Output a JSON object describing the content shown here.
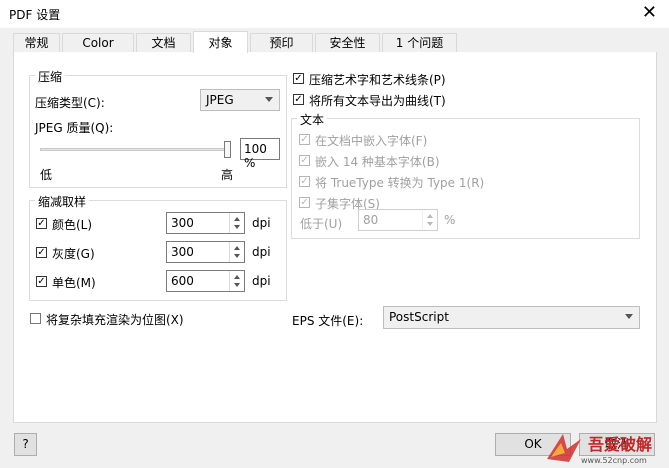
{
  "window": {
    "title": "PDF 设置",
    "close": "✕"
  },
  "tabs": [
    "常规",
    "Color",
    "文档",
    "对象",
    "预印",
    "安全性",
    "1 个问题"
  ],
  "compression": {
    "legend": "压缩",
    "type_label": "压缩类型(C):",
    "type_value": "JPEG",
    "quality_label": "JPEG 质量(Q):",
    "quality_value": "100 %",
    "quality_level_percent": 100,
    "low": "低",
    "high": "高"
  },
  "downsample": {
    "legend": "缩减取样",
    "rows": [
      {
        "label": "颜色(L)",
        "value": "300",
        "unit": "dpi",
        "checked": true
      },
      {
        "label": "灰度(G)",
        "value": "300",
        "unit": "dpi",
        "checked": true
      },
      {
        "label": "单色(M)",
        "value": "600",
        "unit": "dpi",
        "checked": true
      }
    ]
  },
  "render_complex": {
    "label": "将复杂填充渲染为位图(X)",
    "checked": false
  },
  "right": {
    "compress_art": {
      "label": "压缩艺术字和艺术线条(P)",
      "checked": true
    },
    "export_curves": {
      "label": "将所有文本导出为曲线(T)",
      "checked": true
    },
    "text_group": {
      "legend": "文本",
      "embed": "在文档中嵌入字体(F)",
      "base14": "嵌入 14 种基本字体(B)",
      "truetype": "将 TrueType 转换为 Type 1(R)",
      "subset": "子集字体(S)",
      "below_label": "低于(U)",
      "below_value": "80",
      "below_unit": "%"
    },
    "eps_label": "EPS 文件(E):",
    "eps_value": "PostScript"
  },
  "footer": {
    "help": "?",
    "ok": "OK",
    "cancel": "取消"
  },
  "watermark": {
    "text": "吾爱破解",
    "url": "www.52cnp.com"
  }
}
